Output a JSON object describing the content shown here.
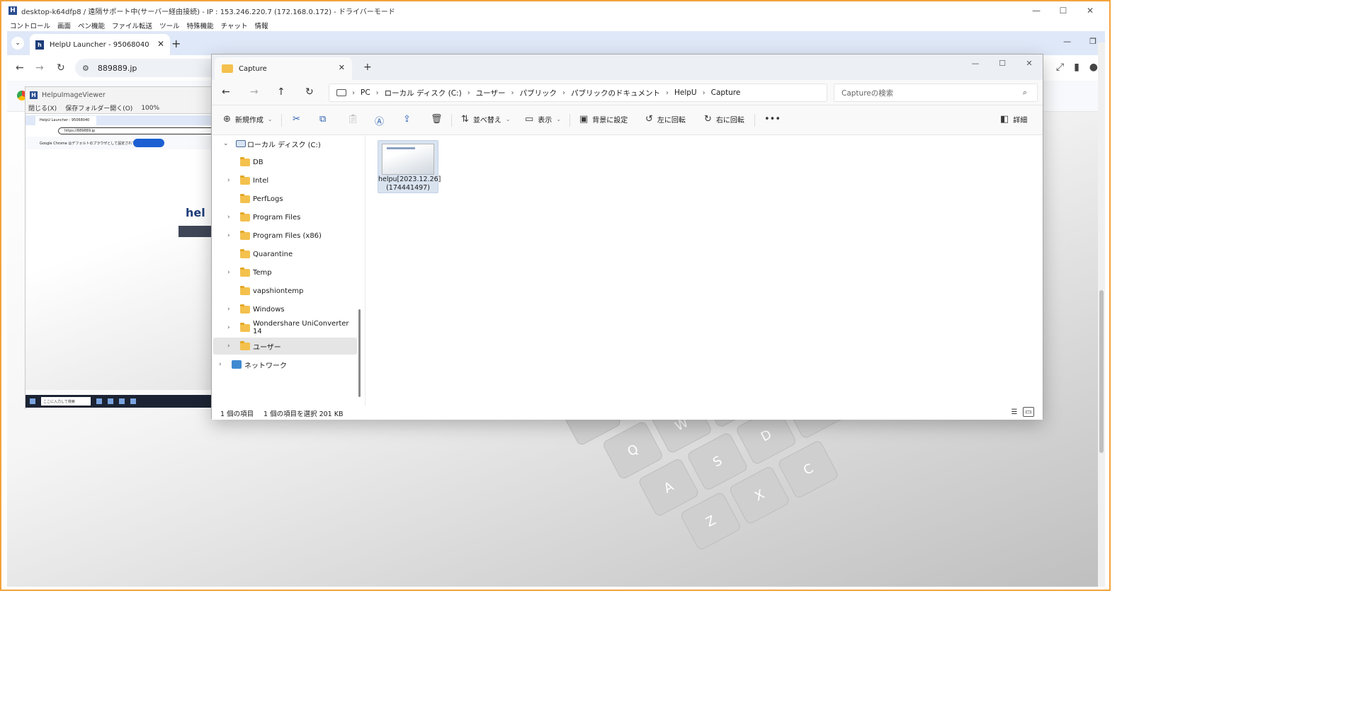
{
  "remote_session": {
    "title": "desktop-k64dfp8 / 遠隔サポート中(サーバー経由接続) - IP : 153.246.220.7 (172.168.0.172) - ドライバーモード",
    "menu": [
      "コントロール",
      "画面",
      "ペン機能",
      "ファイル転送",
      "ツール",
      "特殊機能",
      "チャット",
      "情報"
    ]
  },
  "chrome": {
    "tab_title": "HelpU Launcher - 95068040",
    "url": "889889.jp"
  },
  "image_viewer": {
    "title": "HelpuImageViewer",
    "menu": [
      "閉じる(X)",
      "保存フォルダー開く(O)",
      "100%"
    ],
    "preview": {
      "tab": "HelpU Launcher - 95068040",
      "url": "https://889889.jp",
      "info": "Google Chrome はデフォルトのブラウザとして設定されていません。",
      "search": "ここに入力して検索"
    }
  },
  "explorer": {
    "tab_title": "Capture",
    "breadcrumb": [
      "PC",
      "ローカル ディスク (C:)",
      "ユーザー",
      "パブリック",
      "パブリックのドキュメント",
      "HelpU",
      "Capture"
    ],
    "search_placeholder": "Captureの検索",
    "commands": {
      "new": "新規作成",
      "sort": "並べ替え",
      "view": "表示",
      "set_background": "背景に設定",
      "rotate_left": "左に回転",
      "rotate_right": "右に回転",
      "details": "詳細"
    },
    "tree": {
      "drive": "ローカル ディスク (C:)",
      "folders": [
        "DB",
        "Intel",
        "PerfLogs",
        "Program Files",
        "Program Files (x86)",
        "Quarantine",
        "Temp",
        "vapshiontemp",
        "Windows",
        "Wondershare UniConverter 14",
        "ユーザー"
      ],
      "network": "ネットワーク"
    },
    "file": {
      "name_line1": "helpu[2023.12.26]",
      "name_line2": "(174441497)"
    },
    "status": {
      "count": "1 個の項目",
      "selected": "1 個の項目を選択 201 KB"
    }
  },
  "icons": {
    "back": "arrow-left-icon",
    "forward": "arrow-right-icon",
    "up": "arrow-up-icon",
    "refresh": "refresh-icon",
    "search": "search-icon",
    "cut": "scissors-icon",
    "copy": "copy-icon",
    "paste": "paste-icon",
    "rename": "rename-icon",
    "share": "share-icon",
    "delete": "trash-icon",
    "more": "more-icon"
  },
  "colors": {
    "session_border": "#f3a23a",
    "folder": "#f4c14d",
    "selection": "#e5e5e5",
    "chrome_tabstrip": "#dfe8f8"
  }
}
